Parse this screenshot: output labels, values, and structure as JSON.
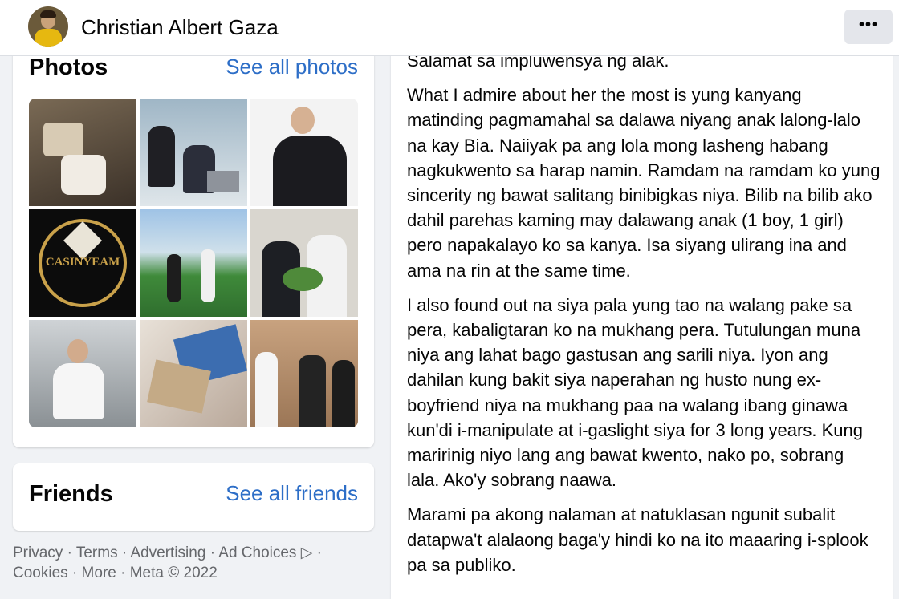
{
  "header": {
    "page_name": "Christian Albert Gaza",
    "more_label": "•••"
  },
  "photos": {
    "title": "Photos",
    "see_all": "See all photos",
    "tiles": [
      {
        "label": ""
      },
      {
        "label": ""
      },
      {
        "label": ""
      },
      {
        "label": "CASINYEAM"
      },
      {
        "label": ""
      },
      {
        "label": ""
      },
      {
        "label": ""
      },
      {
        "label": ""
      },
      {
        "label": ""
      }
    ]
  },
  "friends": {
    "title": "Friends",
    "see_all": "See all friends"
  },
  "footer": {
    "links": [
      "Privacy",
      "Terms",
      "Advertising",
      "Ad Choices",
      "Cookies",
      "More",
      "Meta © 2022"
    ]
  },
  "post": {
    "paragraphs": [
      "Salamat sa impluwensya ng alak.",
      "What I admire about her the most is yung kanyang matinding pagmamahal sa dalawa niyang anak lalong-lalo na kay Bia. Naiiyak pa ang lola mong lasheng habang nagkukwento sa harap namin. Ramdam na ramdam ko yung sincerity ng bawat salitang binibigkas niya. Bilib na bilib ako dahil parehas kaming may dalawang anak (1 boy, 1 girl) pero napakalayo ko sa kanya. Isa siyang ulirang ina and ama na rin at the same time.",
      "I also found out na siya pala yung tao na walang pake sa pera, kabaligtaran ko na mukhang pera. Tutulungan muna niya ang lahat bago gastusan ang sarili niya. Iyon ang dahilan kung bakit siya naperahan ng husto nung ex-boyfriend niya na mukhang paa na walang ibang ginawa kun'di i-manipulate at i-gaslight siya for 3 long years. Kung maririnig niyo lang ang bawat kwento, nako po, sobrang lala. Ako'y sobrang naawa.",
      "Marami pa akong nalaman at natuklasan ngunit subalit datapwa't alalaong baga'y hindi ko na ito maaaring i-splook pa sa publiko."
    ]
  },
  "colors": {
    "link": "#2d6ec7",
    "background": "#f0f2f5",
    "card": "#ffffff",
    "muted": "#65676b"
  }
}
